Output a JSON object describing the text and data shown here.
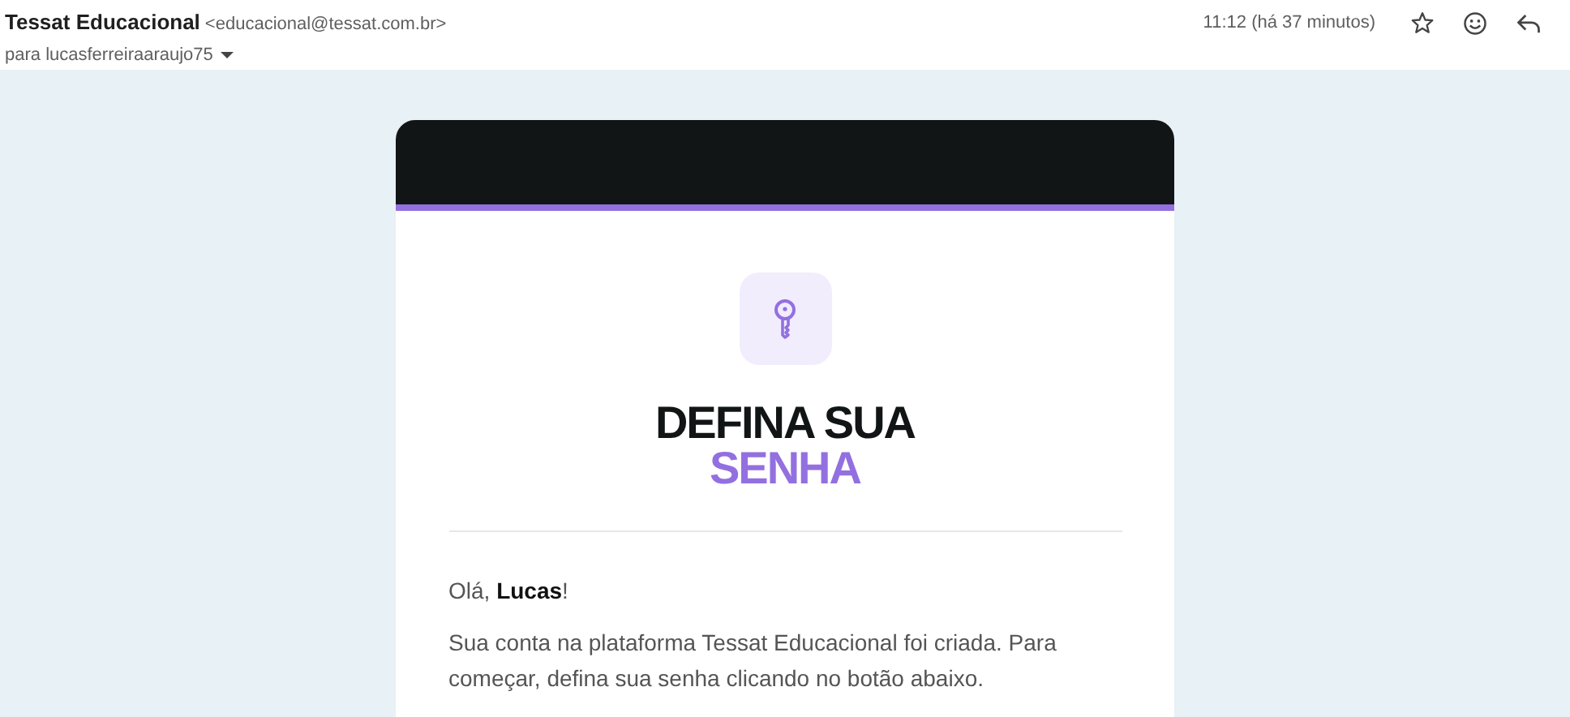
{
  "header": {
    "sender_name": "Tessat Educacional",
    "sender_email": "<educacional@tessat.com.br>",
    "recipient": "para lucasferreiraaraujo75",
    "time": "11:12 (há 37 minutos)",
    "starred": false
  },
  "email": {
    "title_line_1": "DEFINA SUA",
    "title_line_2": "SENHA",
    "greeting": "Olá, **Lucas**!",
    "body": "Sua conta na plataforma Tessat Educacional foi criada. Para começar, defina sua senha clicando no botão abaixo."
  }
}
